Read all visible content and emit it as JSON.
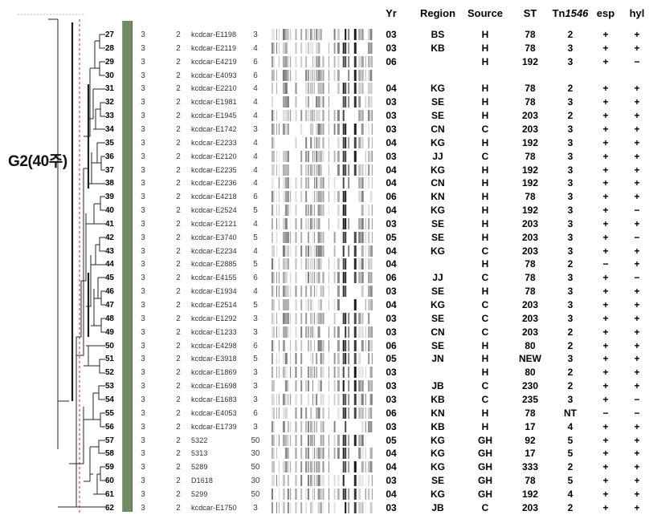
{
  "figure": {
    "group_label": "G2(40주)",
    "accent_bar_color": "#6f8c63",
    "dendrogram_marker_color": "#d94a4a"
  },
  "columns": {
    "row_number": "",
    "col_a": "",
    "col_b": "",
    "strain": "",
    "band_count": "",
    "yr": "Yr",
    "region": "Region",
    "source": "Source",
    "st": "ST",
    "tn": "Tn",
    "tn_italic": "1546",
    "esp": "esp",
    "hyl": "hyl"
  },
  "rows": [
    {
      "no": "27",
      "a": "3",
      "b": "2",
      "strain": "kcdcar-E1198",
      "bands": "3",
      "yr": "03",
      "region": "BS",
      "source": "H",
      "st": "78",
      "tn": "2",
      "esp": "+",
      "hyl": "+"
    },
    {
      "no": "28",
      "a": "3",
      "b": "2",
      "strain": "kcdcar-E2119",
      "bands": "4",
      "yr": "03",
      "region": "KB",
      "source": "H",
      "st": "78",
      "tn": "3",
      "esp": "+",
      "hyl": "+"
    },
    {
      "no": "29",
      "a": "3",
      "b": "2",
      "strain": "kcdcar-E4219",
      "bands": "6",
      "yr": "06",
      "region": "",
      "source": "H",
      "st": "192",
      "tn": "3",
      "esp": "+",
      "hyl": "−"
    },
    {
      "no": "30",
      "a": "3",
      "b": "2",
      "strain": "kcdcar-E4093",
      "bands": "6",
      "yr": "",
      "region": "",
      "source": "",
      "st": "",
      "tn": "",
      "esp": "",
      "hyl": ""
    },
    {
      "no": "31",
      "a": "3",
      "b": "2",
      "strain": "kcdcar-E2210",
      "bands": "4",
      "yr": "04",
      "region": "KG",
      "source": "H",
      "st": "78",
      "tn": "2",
      "esp": "+",
      "hyl": "+"
    },
    {
      "no": "32",
      "a": "3",
      "b": "2",
      "strain": "kcdcar-E1981",
      "bands": "4",
      "yr": "03",
      "region": "SE",
      "source": "H",
      "st": "78",
      "tn": "3",
      "esp": "+",
      "hyl": "+"
    },
    {
      "no": "33",
      "a": "3",
      "b": "2",
      "strain": "kcdcar-E1945",
      "bands": "4",
      "yr": "03",
      "region": "SE",
      "source": "H",
      "st": "203",
      "tn": "2",
      "esp": "+",
      "hyl": "+"
    },
    {
      "no": "34",
      "a": "3",
      "b": "2",
      "strain": "kcdcar-E1742",
      "bands": "3",
      "yr": "03",
      "region": "CN",
      "source": "C",
      "st": "203",
      "tn": "3",
      "esp": "+",
      "hyl": "+"
    },
    {
      "no": "35",
      "a": "3",
      "b": "2",
      "strain": "kcdcar-E2233",
      "bands": "4",
      "yr": "04",
      "region": "KG",
      "source": "H",
      "st": "192",
      "tn": "3",
      "esp": "+",
      "hyl": "+"
    },
    {
      "no": "36",
      "a": "3",
      "b": "2",
      "strain": "kcdcar-E2120",
      "bands": "4",
      "yr": "03",
      "region": "JJ",
      "source": "C",
      "st": "78",
      "tn": "3",
      "esp": "+",
      "hyl": "+"
    },
    {
      "no": "37",
      "a": "3",
      "b": "2",
      "strain": "kcdcar-E2235",
      "bands": "4",
      "yr": "04",
      "region": "KG",
      "source": "H",
      "st": "192",
      "tn": "3",
      "esp": "+",
      "hyl": "+"
    },
    {
      "no": "38",
      "a": "3",
      "b": "2",
      "strain": "kcdcar-E2236",
      "bands": "4",
      "yr": "04",
      "region": "CN",
      "source": "H",
      "st": "192",
      "tn": "3",
      "esp": "+",
      "hyl": "+"
    },
    {
      "no": "39",
      "a": "3",
      "b": "2",
      "strain": "kcdcar-E4218",
      "bands": "6",
      "yr": "06",
      "region": "KN",
      "source": "H",
      "st": "78",
      "tn": "3",
      "esp": "+",
      "hyl": "+"
    },
    {
      "no": "40",
      "a": "3",
      "b": "2",
      "strain": "kcdcar-E2524",
      "bands": "5",
      "yr": "04",
      "region": "KG",
      "source": "H",
      "st": "192",
      "tn": "3",
      "esp": "+",
      "hyl": "−"
    },
    {
      "no": "41",
      "a": "3",
      "b": "2",
      "strain": "kcdcar-E2121",
      "bands": "4",
      "yr": "03",
      "region": "SE",
      "source": "H",
      "st": "203",
      "tn": "3",
      "esp": "+",
      "hyl": "+"
    },
    {
      "no": "42",
      "a": "3",
      "b": "2",
      "strain": "kcdcar-E3740",
      "bands": "5",
      "yr": "05",
      "region": "SE",
      "source": "H",
      "st": "203",
      "tn": "3",
      "esp": "+",
      "hyl": "−"
    },
    {
      "no": "43",
      "a": "3",
      "b": "2",
      "strain": "kcdcar-E2234",
      "bands": "4",
      "yr": "04",
      "region": "KG",
      "source": "C",
      "st": "203",
      "tn": "3",
      "esp": "+",
      "hyl": "+"
    },
    {
      "no": "44",
      "a": "3",
      "b": "2",
      "strain": "kcdcar-E2885",
      "bands": "5",
      "yr": "04",
      "region": "",
      "source": "H",
      "st": "78",
      "tn": "2",
      "esp": "−",
      "hyl": "+"
    },
    {
      "no": "45",
      "a": "3",
      "b": "2",
      "strain": "kcdcar-E4155",
      "bands": "6",
      "yr": "06",
      "region": "JJ",
      "source": "C",
      "st": "78",
      "tn": "3",
      "esp": "+",
      "hyl": "−"
    },
    {
      "no": "46",
      "a": "3",
      "b": "2",
      "strain": "kcdcar-E1934",
      "bands": "4",
      "yr": "03",
      "region": "SE",
      "source": "H",
      "st": "78",
      "tn": "3",
      "esp": "+",
      "hyl": "+"
    },
    {
      "no": "47",
      "a": "3",
      "b": "2",
      "strain": "kcdcar-E2514",
      "bands": "5",
      "yr": "04",
      "region": "KG",
      "source": "C",
      "st": "203",
      "tn": "3",
      "esp": "+",
      "hyl": "+"
    },
    {
      "no": "48",
      "a": "3",
      "b": "2",
      "strain": "kcdcar-E1292",
      "bands": "3",
      "yr": "03",
      "region": "SE",
      "source": "C",
      "st": "203",
      "tn": "3",
      "esp": "+",
      "hyl": "+"
    },
    {
      "no": "49",
      "a": "3",
      "b": "2",
      "strain": "kcdcar-E1233",
      "bands": "3",
      "yr": "03",
      "region": "CN",
      "source": "C",
      "st": "203",
      "tn": "2",
      "esp": "+",
      "hyl": "+"
    },
    {
      "no": "50",
      "a": "3",
      "b": "2",
      "strain": "kcdcar-E4298",
      "bands": "6",
      "yr": "06",
      "region": "SE",
      "source": "H",
      "st": "80",
      "tn": "2",
      "esp": "+",
      "hyl": "+"
    },
    {
      "no": "51",
      "a": "3",
      "b": "2",
      "strain": "kcdcar-E3918",
      "bands": "5",
      "yr": "05",
      "region": "JN",
      "source": "H",
      "st": "NEW",
      "tn": "3",
      "esp": "+",
      "hyl": "+"
    },
    {
      "no": "52",
      "a": "3",
      "b": "2",
      "strain": "kcdcar-E1869",
      "bands": "3",
      "yr": "03",
      "region": "",
      "source": "H",
      "st": "80",
      "tn": "2",
      "esp": "+",
      "hyl": "+"
    },
    {
      "no": "53",
      "a": "3",
      "b": "2",
      "strain": "kcdcar-E1698",
      "bands": "3",
      "yr": "03",
      "region": "JB",
      "source": "C",
      "st": "230",
      "tn": "2",
      "esp": "+",
      "hyl": "+"
    },
    {
      "no": "54",
      "a": "3",
      "b": "2",
      "strain": "kcdcar-E1683",
      "bands": "3",
      "yr": "03",
      "region": "KB",
      "source": "C",
      "st": "235",
      "tn": "3",
      "esp": "+",
      "hyl": "−"
    },
    {
      "no": "55",
      "a": "3",
      "b": "2",
      "strain": "kcdcar-E4053",
      "bands": "6",
      "yr": "06",
      "region": "KN",
      "source": "H",
      "st": "78",
      "tn": "NT",
      "esp": "−",
      "hyl": "−"
    },
    {
      "no": "56",
      "a": "3",
      "b": "2",
      "strain": "kcdcar-E1739",
      "bands": "3",
      "yr": "03",
      "region": "KB",
      "source": "H",
      "st": "17",
      "tn": "4",
      "esp": "+",
      "hyl": "+"
    },
    {
      "no": "57",
      "a": "3",
      "b": "2",
      "strain": "5322",
      "bands": "50",
      "yr": "05",
      "region": "KG",
      "source": "GH",
      "st": "92",
      "tn": "5",
      "esp": "+",
      "hyl": "+"
    },
    {
      "no": "58",
      "a": "3",
      "b": "2",
      "strain": "5313",
      "bands": "30",
      "yr": "04",
      "region": "KG",
      "source": "GH",
      "st": "17",
      "tn": "5",
      "esp": "+",
      "hyl": "+"
    },
    {
      "no": "59",
      "a": "3",
      "b": "2",
      "strain": "5289",
      "bands": "50",
      "yr": "04",
      "region": "KG",
      "source": "GH",
      "st": "333",
      "tn": "2",
      "esp": "+",
      "hyl": "+"
    },
    {
      "no": "60",
      "a": "3",
      "b": "2",
      "strain": "D1618",
      "bands": "30",
      "yr": "03",
      "region": "SE",
      "source": "GH",
      "st": "78",
      "tn": "5",
      "esp": "+",
      "hyl": "+"
    },
    {
      "no": "61",
      "a": "3",
      "b": "2",
      "strain": "5299",
      "bands": "50",
      "yr": "04",
      "region": "KG",
      "source": "GH",
      "st": "192",
      "tn": "4",
      "esp": "+",
      "hyl": "+"
    },
    {
      "no": "62",
      "a": "3",
      "b": "2",
      "strain": "kcdcar-E1750",
      "bands": "3",
      "yr": "03",
      "region": "JB",
      "source": "C",
      "st": "203",
      "tn": "2",
      "esp": "+",
      "hyl": "+"
    }
  ]
}
